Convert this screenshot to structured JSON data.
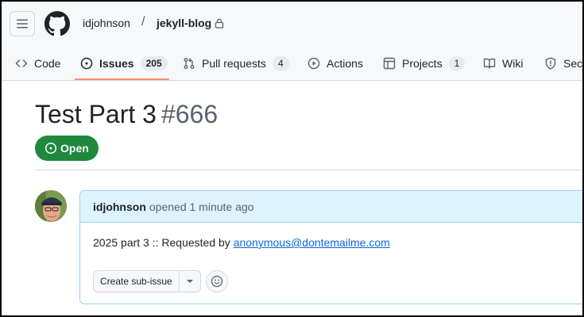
{
  "header": {
    "owner": "idjohnson",
    "separator": "/",
    "repo": "jekyll-blog",
    "menu_icon": "hamburger-icon",
    "logo_icon": "github-mark-icon",
    "lock_icon": "lock-icon"
  },
  "tabs": [
    {
      "label": "Code",
      "icon": "code-icon"
    },
    {
      "label": "Issues",
      "count": "205",
      "icon": "issue-opened-icon",
      "selected": true
    },
    {
      "label": "Pull requests",
      "count": "4",
      "icon": "git-pull-request-icon"
    },
    {
      "label": "Actions",
      "icon": "play-icon"
    },
    {
      "label": "Projects",
      "count": "1",
      "icon": "table-icon"
    },
    {
      "label": "Wiki",
      "icon": "book-icon"
    },
    {
      "label": "Secu",
      "icon": "shield-icon"
    }
  ],
  "issue": {
    "title": "Test Part 3",
    "number": "#666",
    "state": "Open"
  },
  "comment": {
    "author": "idjohnson",
    "action": "opened 1 minute ago",
    "body_prefix": "2025 part 3 :: Requested by ",
    "body_link": "anonymous@dontemailme.com",
    "create_sub_issue_label": "Create sub-issue"
  },
  "colors": {
    "open_green": "#1f883d",
    "tab_underline": "#fd8c73",
    "comment_header_bg": "#ddf4ff",
    "link_blue": "#0969da"
  }
}
